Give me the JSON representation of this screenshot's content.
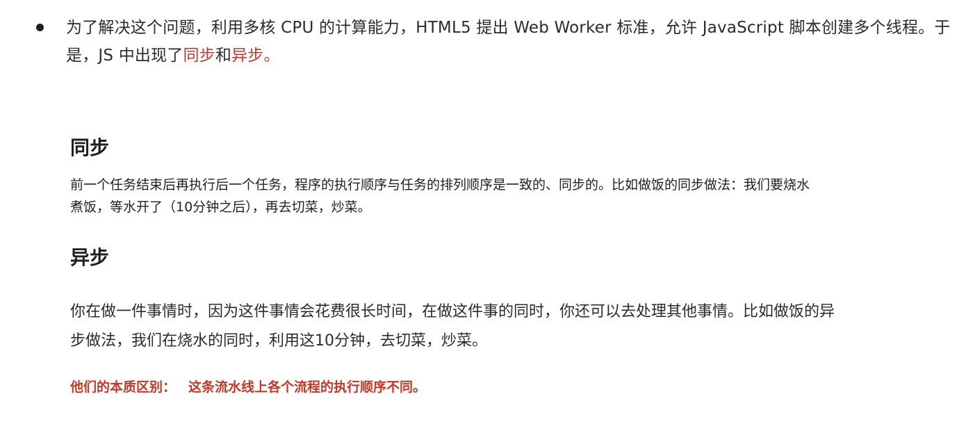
{
  "intro": {
    "text_before": "为了解决这个问题，利用多核 CPU 的计算能力，HTML5 提出 Web Worker 标准，允许 JavaScript 脚本创建多个线程。于是，JS 中出现了",
    "sync_word": "同步",
    "and_word": "和",
    "async_word": "异步。"
  },
  "sync": {
    "heading": "同步",
    "body": "前一个任务结束后再执行后一个任务，程序的执行顺序与任务的排列顺序是一致的、同步的。比如做饭的同步做法：我们要烧水煮饭，等水开了（10分钟之后），再去切菜，炒菜。"
  },
  "async": {
    "heading": "异步",
    "body": "你在做一件事情时，因为这件事情会花费很长时间，在做这件事的同时，你还可以去处理其他事情。比如做饭的异步做法，我们在烧水的同时，利用这10分钟，去切菜，炒菜。"
  },
  "summary": {
    "label": "他们的本质区别：",
    "text": "这条流水线上各个流程的执行顺序不同。"
  },
  "colors": {
    "accent_red": "#c0392b",
    "text": "#2b2b2b"
  }
}
